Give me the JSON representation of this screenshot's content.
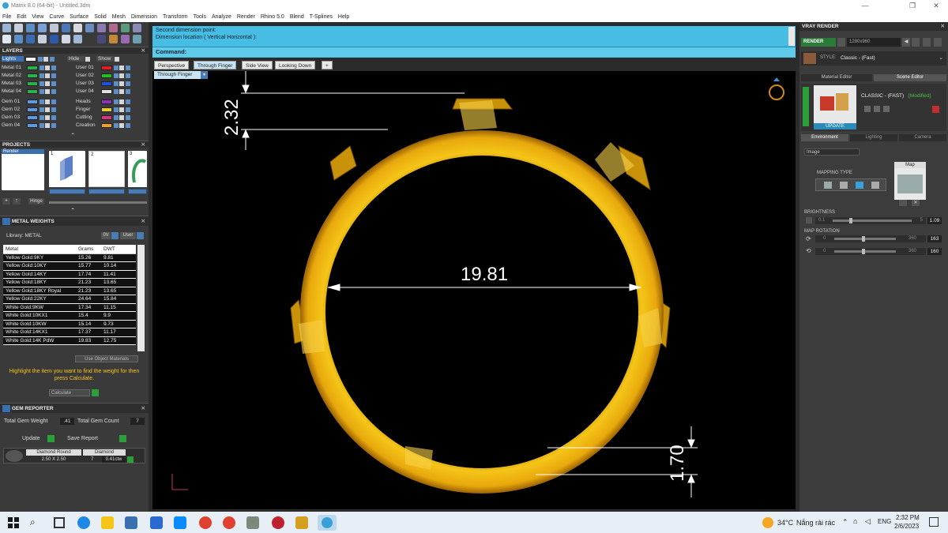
{
  "window": {
    "title": "Matrix 8.0 (64-bit) - Untitled.3dm",
    "min": "—",
    "max": "❐",
    "close": "✕"
  },
  "menu": [
    "File",
    "Edit",
    "View",
    "Curve",
    "Surface",
    "Solid",
    "Mesh",
    "Dimension",
    "Transform",
    "Tools",
    "Analyze",
    "Render",
    "Rhino 5.0",
    "Blend",
    "T-Splines",
    "Help"
  ],
  "command": {
    "line1": "Second dimension point:",
    "line2": "Dimension location ( Vertical  Horizontal ):",
    "label": "Command:"
  },
  "viewport_tabs": [
    "Perspective",
    "Through Finger",
    "Side View",
    "Looking Down",
    "+"
  ],
  "viewport_name": "Through Finger",
  "dimensions": {
    "top_thickness": "2.32",
    "diameter": "19.81",
    "bottom_thickness": "1.70"
  },
  "layers": {
    "title": "LAYERS",
    "lights": "Lights",
    "hide": "Hide",
    "show": "Show",
    "left": [
      {
        "name": "Metal 01",
        "color": "#2bb34a"
      },
      {
        "name": "Metal 02",
        "color": "#2bb34a"
      },
      {
        "name": "Metal 03",
        "color": "#2bb34a"
      },
      {
        "name": "Metal 04",
        "color": "#2bb34a"
      },
      {
        "name": "Gem 01",
        "color": "#5b9be6"
      },
      {
        "name": "Gem 02",
        "color": "#5b9be6"
      },
      {
        "name": "Gem 03",
        "color": "#5b9be6"
      },
      {
        "name": "Gem 04",
        "color": "#5b9be6"
      }
    ],
    "right": [
      {
        "name": "User 01",
        "color": "#e02020"
      },
      {
        "name": "User 02",
        "color": "#20c020"
      },
      {
        "name": "User 03",
        "color": "#2050e0"
      },
      {
        "name": "User 04",
        "color": "#e0e0e0"
      },
      {
        "name": "Heads",
        "color": "#9030c0"
      },
      {
        "name": "Finger",
        "color": "#e8d020"
      },
      {
        "name": "Cutting",
        "color": "#e03080"
      },
      {
        "name": "Creation",
        "color": "#f0a020"
      }
    ]
  },
  "projects": {
    "title": "PROJECTS",
    "item": "Render",
    "hinge": "Hinge",
    "thumbs": [
      "1",
      "2",
      "3"
    ]
  },
  "metal_weights": {
    "title": "METAL WEIGHTS",
    "library": "Library: METAL",
    "box": "0V",
    "user": "User",
    "headers": [
      "Metal",
      "Grams",
      "DWT"
    ],
    "rows": [
      [
        "Yellow Gold:9KY",
        "15.26",
        "9.81"
      ],
      [
        "Yellow Gold:10KY",
        "15.77",
        "10.14"
      ],
      [
        "Yellow Gold:14KY",
        "17.74",
        "11.41"
      ],
      [
        "Yellow Gold:18KY",
        "21.23",
        "13.65"
      ],
      [
        "Yellow Gold:18KY Royal",
        "21.23",
        "13.65"
      ],
      [
        "Yellow Gold:22KY",
        "24.64",
        "15.84"
      ],
      [
        "White Gold:9KW",
        "17.34",
        "11.15"
      ],
      [
        "White Gold:10KX1",
        "15.4",
        "9.9"
      ],
      [
        "White Gold:10KW",
        "15.14",
        "9.73"
      ],
      [
        "White Gold:14KX1",
        "17.37",
        "11.17"
      ],
      [
        "White Gold:14K PdW",
        "19.83",
        "12.75"
      ]
    ],
    "use_object": "Use Object Materials",
    "hint": "Highlight the item you want to find the weight for then press Calculate.",
    "calculate": "Calculate"
  },
  "gem_reporter": {
    "title": "GEM REPORTER",
    "total_weight_label": "Total Gem Weight",
    "total_weight": ".41",
    "total_count_label": "Total Gem Count",
    "total_count": "7",
    "update": "Update",
    "save_report": "Save Report",
    "gem_name": "Diamond Round",
    "gem_size": "2.50 X 2.50",
    "gem_type": "Diamond",
    "gem_count": "7",
    "gem_ctw": "0.41ctw"
  },
  "vray": {
    "title": "VRAY RENDER",
    "render": "RENDER",
    "res": "1280x960",
    "style_label": "STYLE:",
    "style": "Classic - (Fast)",
    "tabs": [
      "Material Editor",
      "Scene Editor"
    ],
    "scene_name": "CLASSIC - (FAST)",
    "modified": "[Modified]",
    "update": "UPDATE",
    "env_tabs": [
      "Environment",
      "Lighting",
      "Camera"
    ],
    "image_select": "Image",
    "mapping_type": "MAPPING TYPE",
    "map": "Map",
    "brightness_label": "BRIGHTNESS",
    "brightness_min": "0.1",
    "brightness_max": "5",
    "brightness_val": "1.09",
    "brightness_level": 0.21,
    "map_rotation_label": "MAP ROTATION",
    "rot1_min": "0",
    "rot1_max": "360",
    "rot1_val": "163",
    "rot2_min": "0",
    "rot2_max": "360",
    "rot2_val": "160"
  },
  "taskbar": {
    "weather_temp": "34°C",
    "weather_text": "Nắng rải rác",
    "time": "2:32 PM",
    "date": "2/6/2023"
  },
  "colors": {
    "gold": "#e8a80c",
    "cmd_bg": "#47bde4",
    "accent": "#2a7ab8"
  }
}
